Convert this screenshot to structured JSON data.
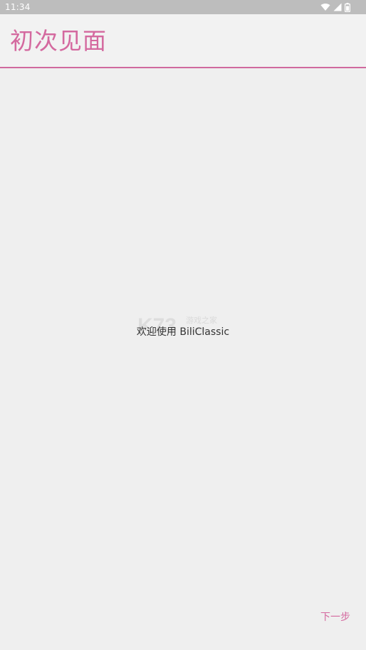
{
  "status_bar": {
    "time": "11:34",
    "icons": [
      "wifi-icon",
      "signal-icon",
      "battery-icon"
    ]
  },
  "toolbar": {
    "title": "初次见面"
  },
  "content": {
    "welcome": "欢迎使用 BiliClassic"
  },
  "footer": {
    "next_label": "下一步"
  },
  "watermark": {
    "logo_text": "K73",
    "site_text": "游戏之家",
    "domain_text": ".com"
  },
  "colors": {
    "accent": "#d4699f",
    "status_bar": "#bdbdbd",
    "background": "#efefef"
  }
}
